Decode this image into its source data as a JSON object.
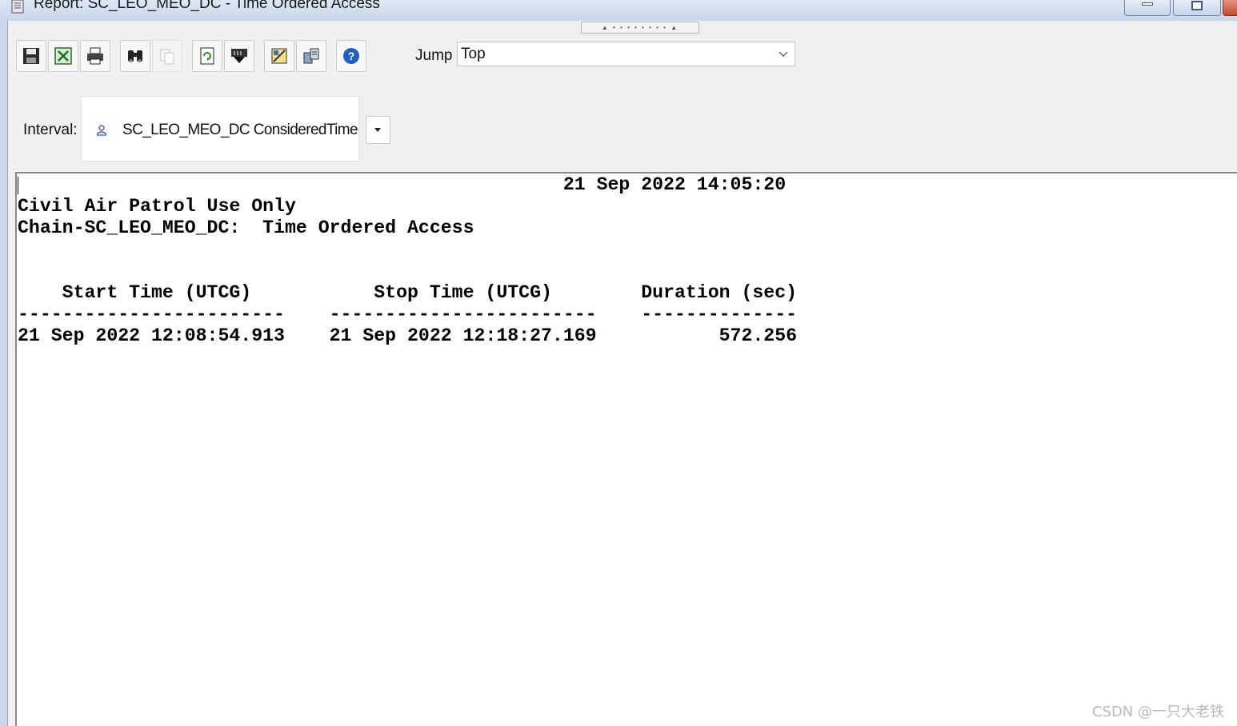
{
  "window": {
    "title": "Report:  SC_LEO_MEO_DC - Time Ordered Access"
  },
  "toolbar": {
    "buttons": [
      {
        "icon": "save-icon"
      },
      {
        "icon": "excel-export-icon"
      },
      {
        "icon": "print-icon"
      },
      {
        "icon": "find-binoculars-icon"
      },
      {
        "icon": "copy-icon",
        "enabled": false
      },
      {
        "icon": "refresh-icon"
      },
      {
        "icon": "insert-report-icon"
      },
      {
        "icon": "report-style-icon"
      },
      {
        "icon": "report-manager-icon"
      },
      {
        "icon": "help-icon"
      }
    ],
    "jump_label": "Jump",
    "jump_value": "Top"
  },
  "interval": {
    "label": "Interval:",
    "value": "SC_LEO_MEO_DC ConsideredTimeS"
  },
  "report": {
    "lines": [
      "                                                 21 Sep 2022 14:05:20",
      "Civil Air Patrol Use Only",
      "Chain-SC_LEO_MEO_DC:  Time Ordered Access",
      "",
      "",
      "    Start Time (UTCG)           Stop Time (UTCG)        Duration (sec)",
      "------------------------    ------------------------    --------------",
      "21 Sep 2022 12:08:54.913    21 Sep 2022 12:18:27.169           572.256"
    ],
    "table": {
      "columns": [
        "Start Time (UTCG)",
        "Stop Time (UTCG)",
        "Duration (sec)"
      ],
      "rows": [
        [
          "21 Sep 2022 12:08:54.913",
          "21 Sep 2022 12:18:27.169",
          "572.256"
        ]
      ]
    }
  },
  "watermark": "CSDN @一只大老铁"
}
